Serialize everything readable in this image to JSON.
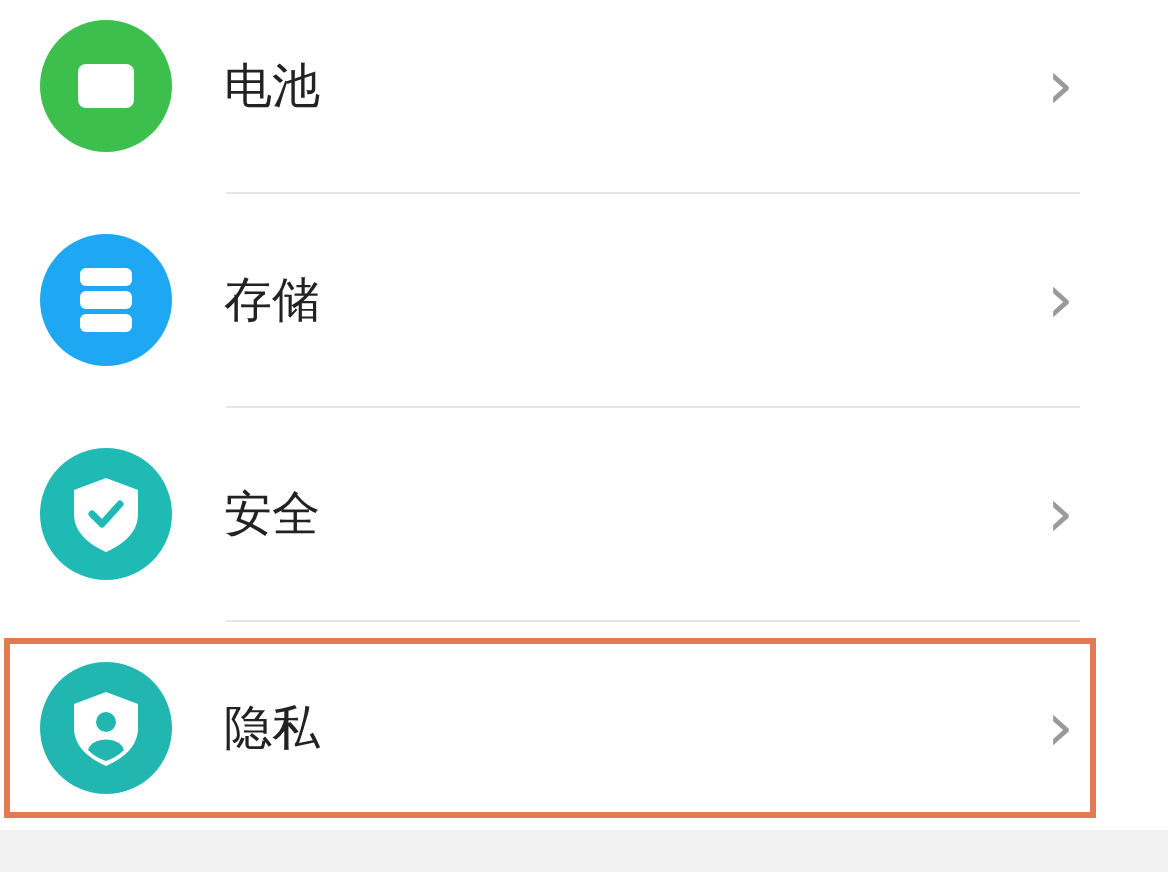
{
  "items": [
    {
      "label": "电池",
      "kind": "battery",
      "color": "#3cbf4c",
      "highlighted": false,
      "chevron": "›"
    },
    {
      "label": "存储",
      "kind": "storage",
      "color": "#1ea7f2",
      "highlighted": false,
      "chevron": "›"
    },
    {
      "label": "安全",
      "kind": "security",
      "color": "#1fbab3",
      "highlighted": false,
      "chevron": "›"
    },
    {
      "label": "隐私",
      "kind": "privacy",
      "color": "#22b6b0",
      "highlighted": true,
      "chevron": "›"
    }
  ]
}
